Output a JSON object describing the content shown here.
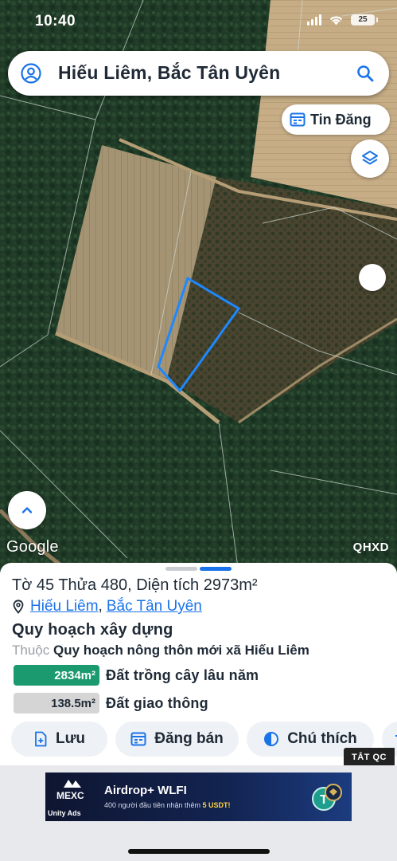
{
  "status_bar": {
    "time": "10:40",
    "battery": "25"
  },
  "search": {
    "location_text": "Hiếu Liêm, Bắc Tân Uyên"
  },
  "map": {
    "tin_dang_label": "Tin Đăng",
    "google_logo": "Google",
    "layer_code": "QHXD",
    "parcel_outline_color": "#1e88ff"
  },
  "sheet": {
    "parcel_title": "Tờ 45 Thửa 480, Diện tích 2973m²",
    "commune_link": "Hiếu Liêm",
    "separator": ",",
    "district_link": "Bắc Tân Uyên",
    "section_heading": "Quy hoạch xây dựng",
    "belongs_prefix": "Thuộc",
    "belongs_plan": "Quy hoạch nông thôn mới xã Hiếu Liêm",
    "areas": [
      {
        "area": "2834m²",
        "label": "Đất trồng cây lâu năm",
        "color": "#1a9a6e"
      },
      {
        "area": "138.5m²",
        "label": "Đất giao thông",
        "color": "#d5d5d5"
      }
    ],
    "actions": [
      {
        "label": "Lưu",
        "icon": "file-plus-icon"
      },
      {
        "label": "Đăng bán",
        "icon": "calendar-list-icon"
      },
      {
        "label": "Chú thích",
        "icon": "half-circle-icon"
      }
    ]
  },
  "ad": {
    "close_label": "TẮT QC",
    "brand": "MEXC",
    "network": "Unity Ads",
    "title": "Airdrop+ WLFI",
    "subtitle_prefix": "400 người đầu tiên nhận thêm",
    "subtitle_highlight": "5 USDT!"
  },
  "colors": {
    "accent": "#1a73e8",
    "green_badge": "#1a9a6e",
    "dark_text": "#1f2a36"
  }
}
